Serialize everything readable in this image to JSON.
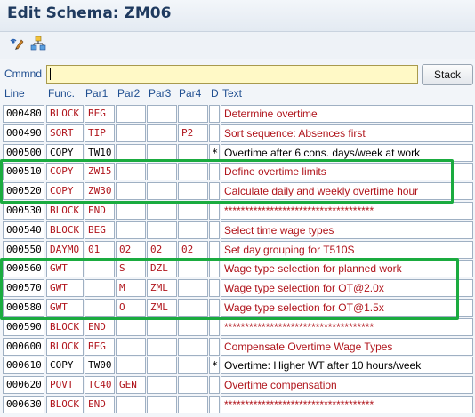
{
  "title": "Edit Schema: ZM06",
  "toolbar": {
    "icons": [
      "display-change-icon",
      "hierarchy-icon"
    ]
  },
  "command": {
    "label": "Cmmnd",
    "value": "",
    "stack_label": "Stack"
  },
  "columns": {
    "line": "Line",
    "func": "Func.",
    "par1": "Par1",
    "par2": "Par2",
    "par3": "Par3",
    "par4": "Par4",
    "d": "D",
    "text": "Text"
  },
  "rows": [
    {
      "line": "000480",
      "func": "BLOCK",
      "par1": "BEG",
      "par2": "",
      "par3": "",
      "par4": "",
      "d": "",
      "text": "Determine overtime",
      "color": "red"
    },
    {
      "line": "000490",
      "func": "SORT",
      "par1": "TIP",
      "par2": "",
      "par3": "",
      "par4": "P2",
      "d": "",
      "text": "Sort sequence: Absences first",
      "color": "red"
    },
    {
      "line": "000500",
      "func": "COPY",
      "par1": "TW10",
      "par2": "",
      "par3": "",
      "par4": "",
      "d": "*",
      "text": "Overtime after 6 cons. days/week at work",
      "color": "black"
    },
    {
      "line": "000510",
      "func": "COPY",
      "par1": "ZW15",
      "par2": "",
      "par3": "",
      "par4": "",
      "d": "",
      "text": "Define overtime limits",
      "color": "red"
    },
    {
      "line": "000520",
      "func": "COPY",
      "par1": "ZW30",
      "par2": "",
      "par3": "",
      "par4": "",
      "d": "",
      "text": "Calculate daily and weekly overtime hour",
      "color": "red"
    },
    {
      "line": "000530",
      "func": "BLOCK",
      "par1": "END",
      "par2": "",
      "par3": "",
      "par4": "",
      "d": "",
      "text": "************************************",
      "color": "red"
    },
    {
      "line": "000540",
      "func": "BLOCK",
      "par1": "BEG",
      "par2": "",
      "par3": "",
      "par4": "",
      "d": "",
      "text": "Select time wage types",
      "color": "red"
    },
    {
      "line": "000550",
      "func": "DAYMO",
      "par1": "01",
      "par2": "02",
      "par3": "02",
      "par4": "02",
      "d": "",
      "text": "Set day grouping for T510S",
      "color": "red"
    },
    {
      "line": "000560",
      "func": "GWT",
      "par1": "",
      "par2": "S",
      "par3": "DZL",
      "par4": "",
      "d": "",
      "text": "Wage type selection for planned work",
      "color": "red"
    },
    {
      "line": "000570",
      "func": "GWT",
      "par1": "",
      "par2": "M",
      "par3": "ZML",
      "par4": "",
      "d": "",
      "text": "Wage type selection for OT@2.0x",
      "color": "red"
    },
    {
      "line": "000580",
      "func": "GWT",
      "par1": "",
      "par2": "O",
      "par3": "ZML",
      "par4": "",
      "d": "",
      "text": "Wage type selection for OT@1.5x",
      "color": "red"
    },
    {
      "line": "000590",
      "func": "BLOCK",
      "par1": "END",
      "par2": "",
      "par3": "",
      "par4": "",
      "d": "",
      "text": "************************************",
      "color": "red"
    },
    {
      "line": "000600",
      "func": "BLOCK",
      "par1": "BEG",
      "par2": "",
      "par3": "",
      "par4": "",
      "d": "",
      "text": "Compensate Overtime Wage Types",
      "color": "red"
    },
    {
      "line": "000610",
      "func": "COPY",
      "par1": "TW00",
      "par2": "",
      "par3": "",
      "par4": "",
      "d": "*",
      "text": "Overtime: Higher WT after 10 hours/week",
      "color": "black"
    },
    {
      "line": "000620",
      "func": "POVT",
      "par1": "TC40",
      "par2": "GEN",
      "par3": "",
      "par4": "",
      "d": "",
      "text": "Overtime compensation",
      "color": "red"
    },
    {
      "line": "000630",
      "func": "BLOCK",
      "par1": "END",
      "par2": "",
      "par3": "",
      "par4": "",
      "d": "",
      "text": "************************************",
      "color": "red"
    }
  ],
  "colors": {
    "accent_red": "#b0151c",
    "highlight_green": "#1aab3f",
    "label_blue": "#1f4e90",
    "command_bg": "#fff9c6"
  }
}
